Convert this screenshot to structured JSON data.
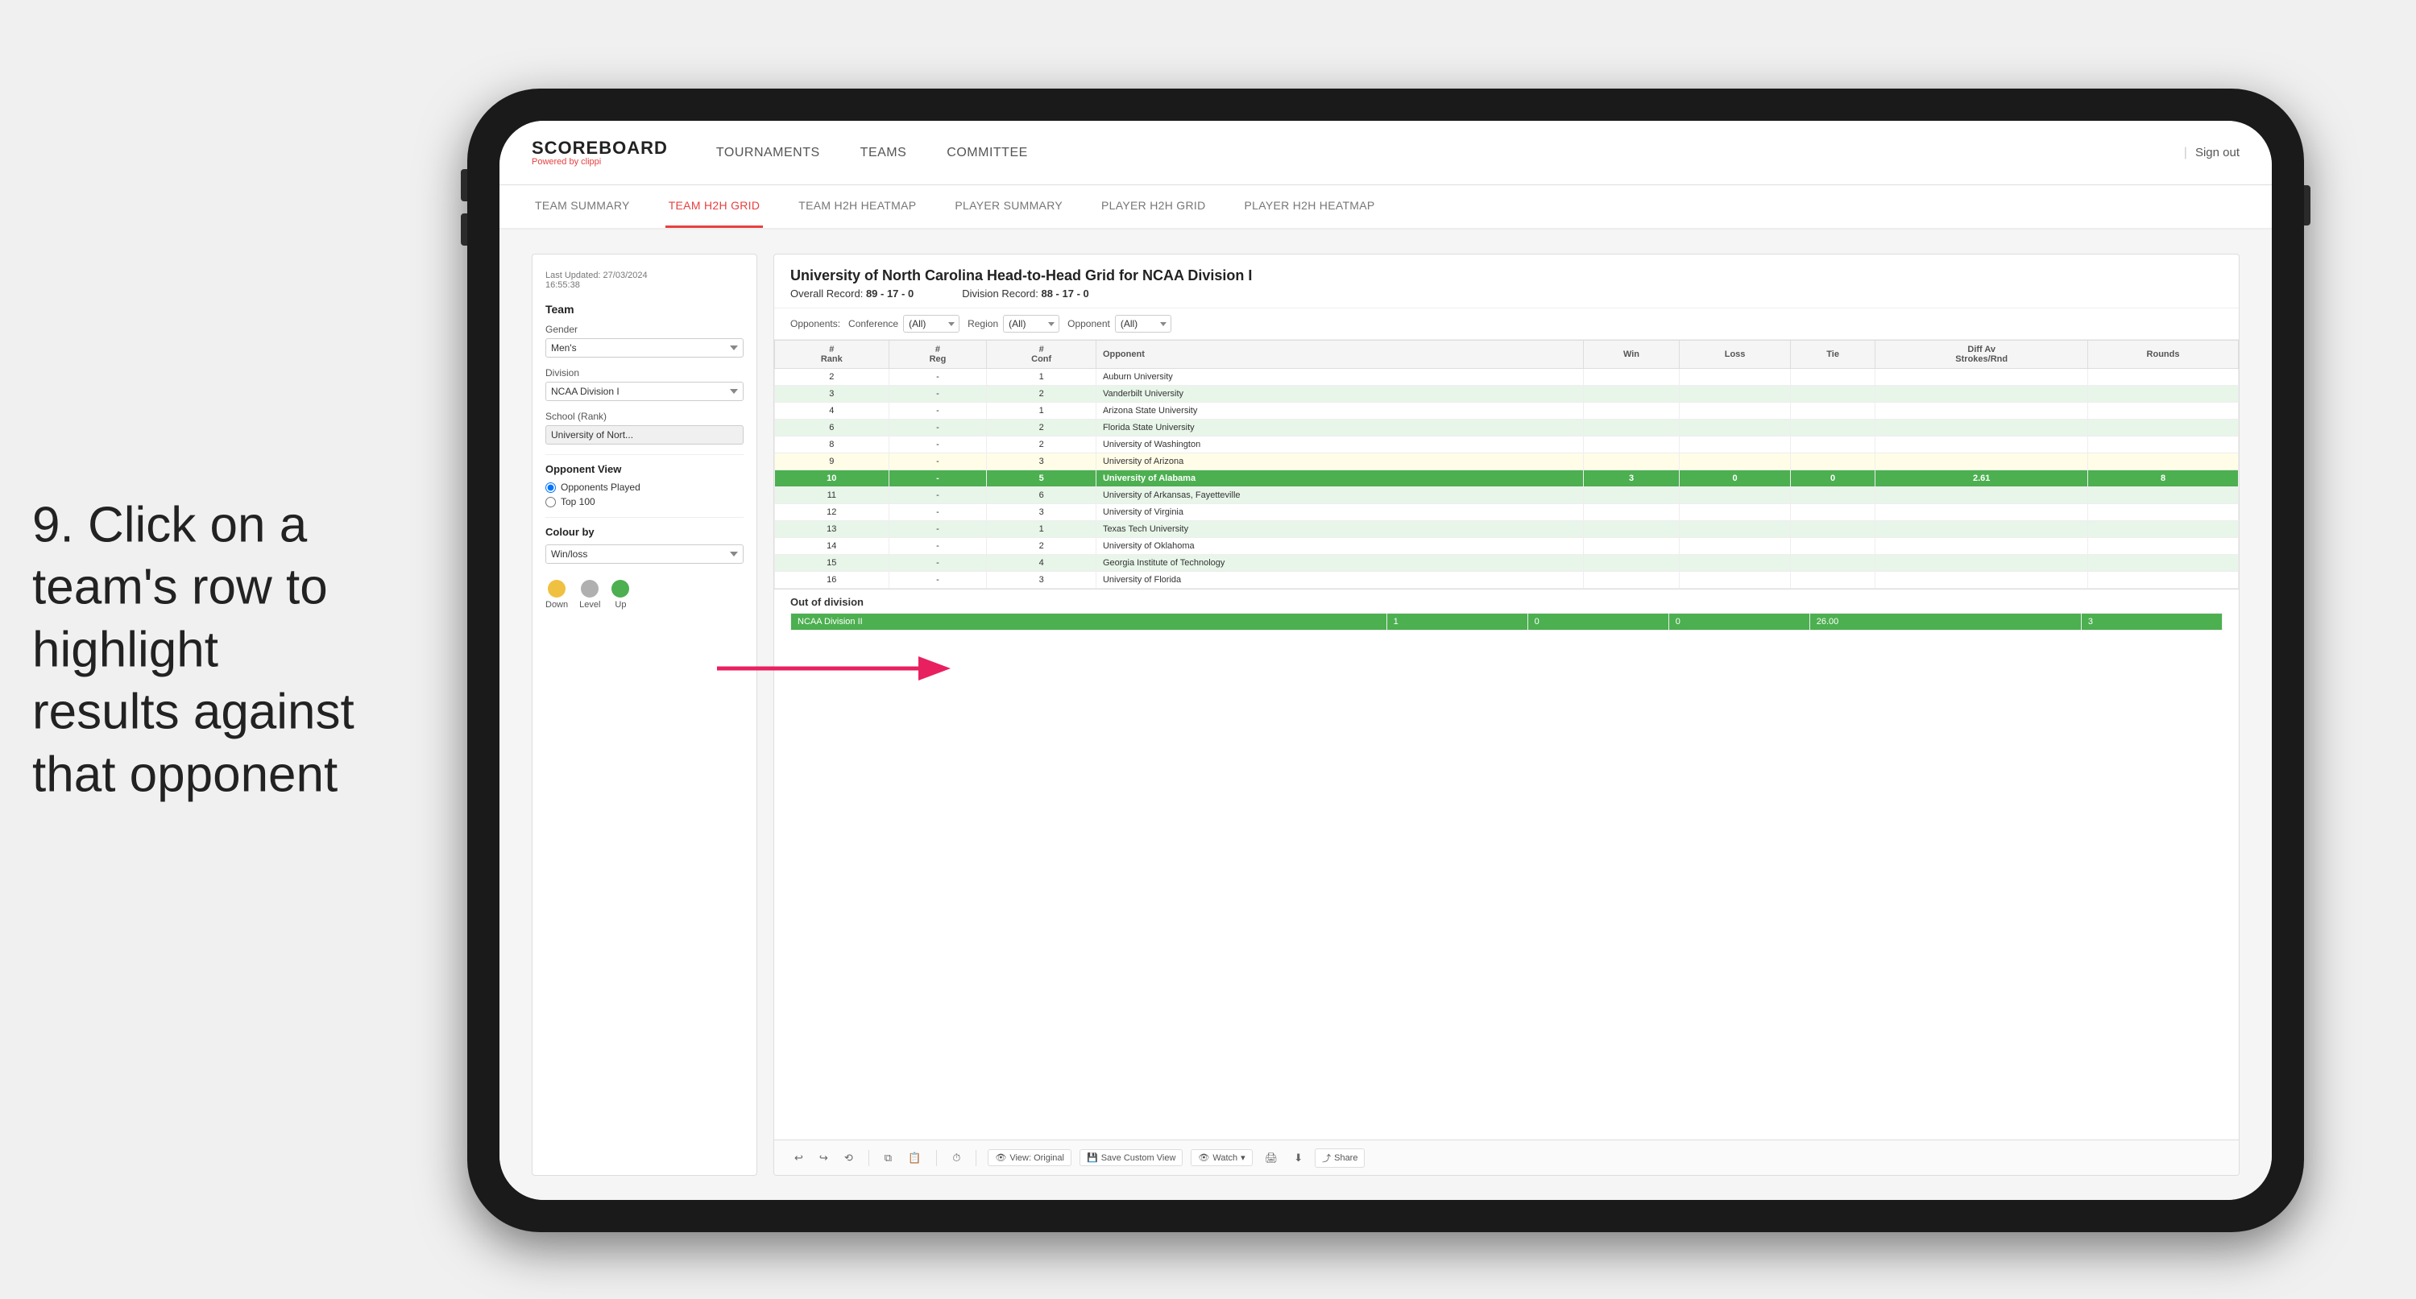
{
  "instruction": {
    "number": "9.",
    "text": "Click on a team's row to highlight results against that opponent"
  },
  "app": {
    "logo": {
      "title": "SCOREBOARD",
      "subtitle_prefix": "Powered by ",
      "subtitle_brand": "clippi"
    },
    "nav": {
      "items": [
        {
          "label": "TOURNAMENTS",
          "id": "tournaments"
        },
        {
          "label": "TEAMS",
          "id": "teams"
        },
        {
          "label": "COMMITTEE",
          "id": "committee"
        }
      ],
      "sign_out": "Sign out"
    },
    "sub_nav": {
      "items": [
        {
          "label": "TEAM SUMMARY",
          "id": "team-summary",
          "active": false
        },
        {
          "label": "TEAM H2H GRID",
          "id": "team-h2h-grid",
          "active": true
        },
        {
          "label": "TEAM H2H HEATMAP",
          "id": "team-h2h-heatmap",
          "active": false
        },
        {
          "label": "PLAYER SUMMARY",
          "id": "player-summary",
          "active": false
        },
        {
          "label": "PLAYER H2H GRID",
          "id": "player-h2h-grid",
          "active": false
        },
        {
          "label": "PLAYER H2H HEATMAP",
          "id": "player-h2h-heatmap",
          "active": false
        }
      ]
    }
  },
  "left_panel": {
    "last_updated_label": "Last Updated: 27/03/2024",
    "last_updated_time": "16:55:38",
    "team_label": "Team",
    "gender_label": "Gender",
    "gender_value": "Men's",
    "division_label": "Division",
    "division_value": "NCAA Division I",
    "school_label": "School (Rank)",
    "school_value": "University of Nort...",
    "opponent_view_label": "Opponent View",
    "radio_opponents": "Opponents Played",
    "radio_top100": "Top 100",
    "colour_by_label": "Colour by",
    "colour_value": "Win/loss",
    "legend": {
      "down_label": "Down",
      "level_label": "Level",
      "up_label": "Up",
      "down_color": "#f0c040",
      "level_color": "#b0b0b0",
      "up_color": "#4caf50"
    }
  },
  "grid": {
    "title": "University of North Carolina Head-to-Head Grid for NCAA Division I",
    "overall_record_label": "Overall Record:",
    "overall_record_value": "89 - 17 - 0",
    "division_record_label": "Division Record:",
    "division_record_value": "88 - 17 - 0",
    "filters": {
      "opponents_label": "Opponents:",
      "conference_label": "Conference",
      "conference_value": "(All)",
      "region_label": "Region",
      "region_value": "(All)",
      "opponent_label": "Opponent",
      "opponent_value": "(All)"
    },
    "columns": {
      "rank": "#\nRank",
      "reg": "#\nReg",
      "conf": "#\nConf",
      "opponent": "Opponent",
      "win": "Win",
      "loss": "Loss",
      "tie": "Tie",
      "diff_av": "Diff Av\nStrokes/Rnd",
      "rounds": "Rounds"
    },
    "rows": [
      {
        "rank": "2",
        "reg": "-",
        "conf": "1",
        "opponent": "Auburn University",
        "win": "",
        "loss": "",
        "tie": "",
        "diff": "",
        "rounds": "",
        "style": "normal"
      },
      {
        "rank": "3",
        "reg": "-",
        "conf": "2",
        "opponent": "Vanderbilt University",
        "win": "",
        "loss": "",
        "tie": "",
        "diff": "",
        "rounds": "",
        "style": "light-green"
      },
      {
        "rank": "4",
        "reg": "-",
        "conf": "1",
        "opponent": "Arizona State University",
        "win": "",
        "loss": "",
        "tie": "",
        "diff": "",
        "rounds": "",
        "style": "normal"
      },
      {
        "rank": "6",
        "reg": "-",
        "conf": "2",
        "opponent": "Florida State University",
        "win": "",
        "loss": "",
        "tie": "",
        "diff": "",
        "rounds": "",
        "style": "light-green"
      },
      {
        "rank": "8",
        "reg": "-",
        "conf": "2",
        "opponent": "University of Washington",
        "win": "",
        "loss": "",
        "tie": "",
        "diff": "",
        "rounds": "",
        "style": "normal"
      },
      {
        "rank": "9",
        "reg": "-",
        "conf": "3",
        "opponent": "University of Arizona",
        "win": "",
        "loss": "",
        "tie": "",
        "diff": "",
        "rounds": "",
        "style": "light-yellow"
      },
      {
        "rank": "10",
        "reg": "-",
        "conf": "5",
        "opponent": "University of Alabama",
        "win": "3",
        "loss": "0",
        "tie": "0",
        "diff": "2.61",
        "rounds": "8",
        "style": "highlighted"
      },
      {
        "rank": "11",
        "reg": "-",
        "conf": "6",
        "opponent": "University of Arkansas, Fayetteville",
        "win": "",
        "loss": "",
        "tie": "",
        "diff": "",
        "rounds": "",
        "style": "light-green"
      },
      {
        "rank": "12",
        "reg": "-",
        "conf": "3",
        "opponent": "University of Virginia",
        "win": "",
        "loss": "",
        "tie": "",
        "diff": "",
        "rounds": "",
        "style": "normal"
      },
      {
        "rank": "13",
        "reg": "-",
        "conf": "1",
        "opponent": "Texas Tech University",
        "win": "",
        "loss": "",
        "tie": "",
        "diff": "",
        "rounds": "",
        "style": "light-green"
      },
      {
        "rank": "14",
        "reg": "-",
        "conf": "2",
        "opponent": "University of Oklahoma",
        "win": "",
        "loss": "",
        "tie": "",
        "diff": "",
        "rounds": "",
        "style": "normal"
      },
      {
        "rank": "15",
        "reg": "-",
        "conf": "4",
        "opponent": "Georgia Institute of Technology",
        "win": "",
        "loss": "",
        "tie": "",
        "diff": "",
        "rounds": "",
        "style": "light-green"
      },
      {
        "rank": "16",
        "reg": "-",
        "conf": "3",
        "opponent": "University of Florida",
        "win": "",
        "loss": "",
        "tie": "",
        "diff": "",
        "rounds": "",
        "style": "normal"
      }
    ],
    "out_of_division": {
      "title": "Out of division",
      "row": {
        "label": "NCAA Division II",
        "win": "1",
        "loss": "0",
        "tie": "0",
        "diff": "26.00",
        "rounds": "3",
        "style": "highlighted"
      }
    }
  },
  "toolbar": {
    "view_label": "View: Original",
    "save_custom_label": "Save Custom View",
    "watch_label": "Watch",
    "share_label": "Share"
  }
}
